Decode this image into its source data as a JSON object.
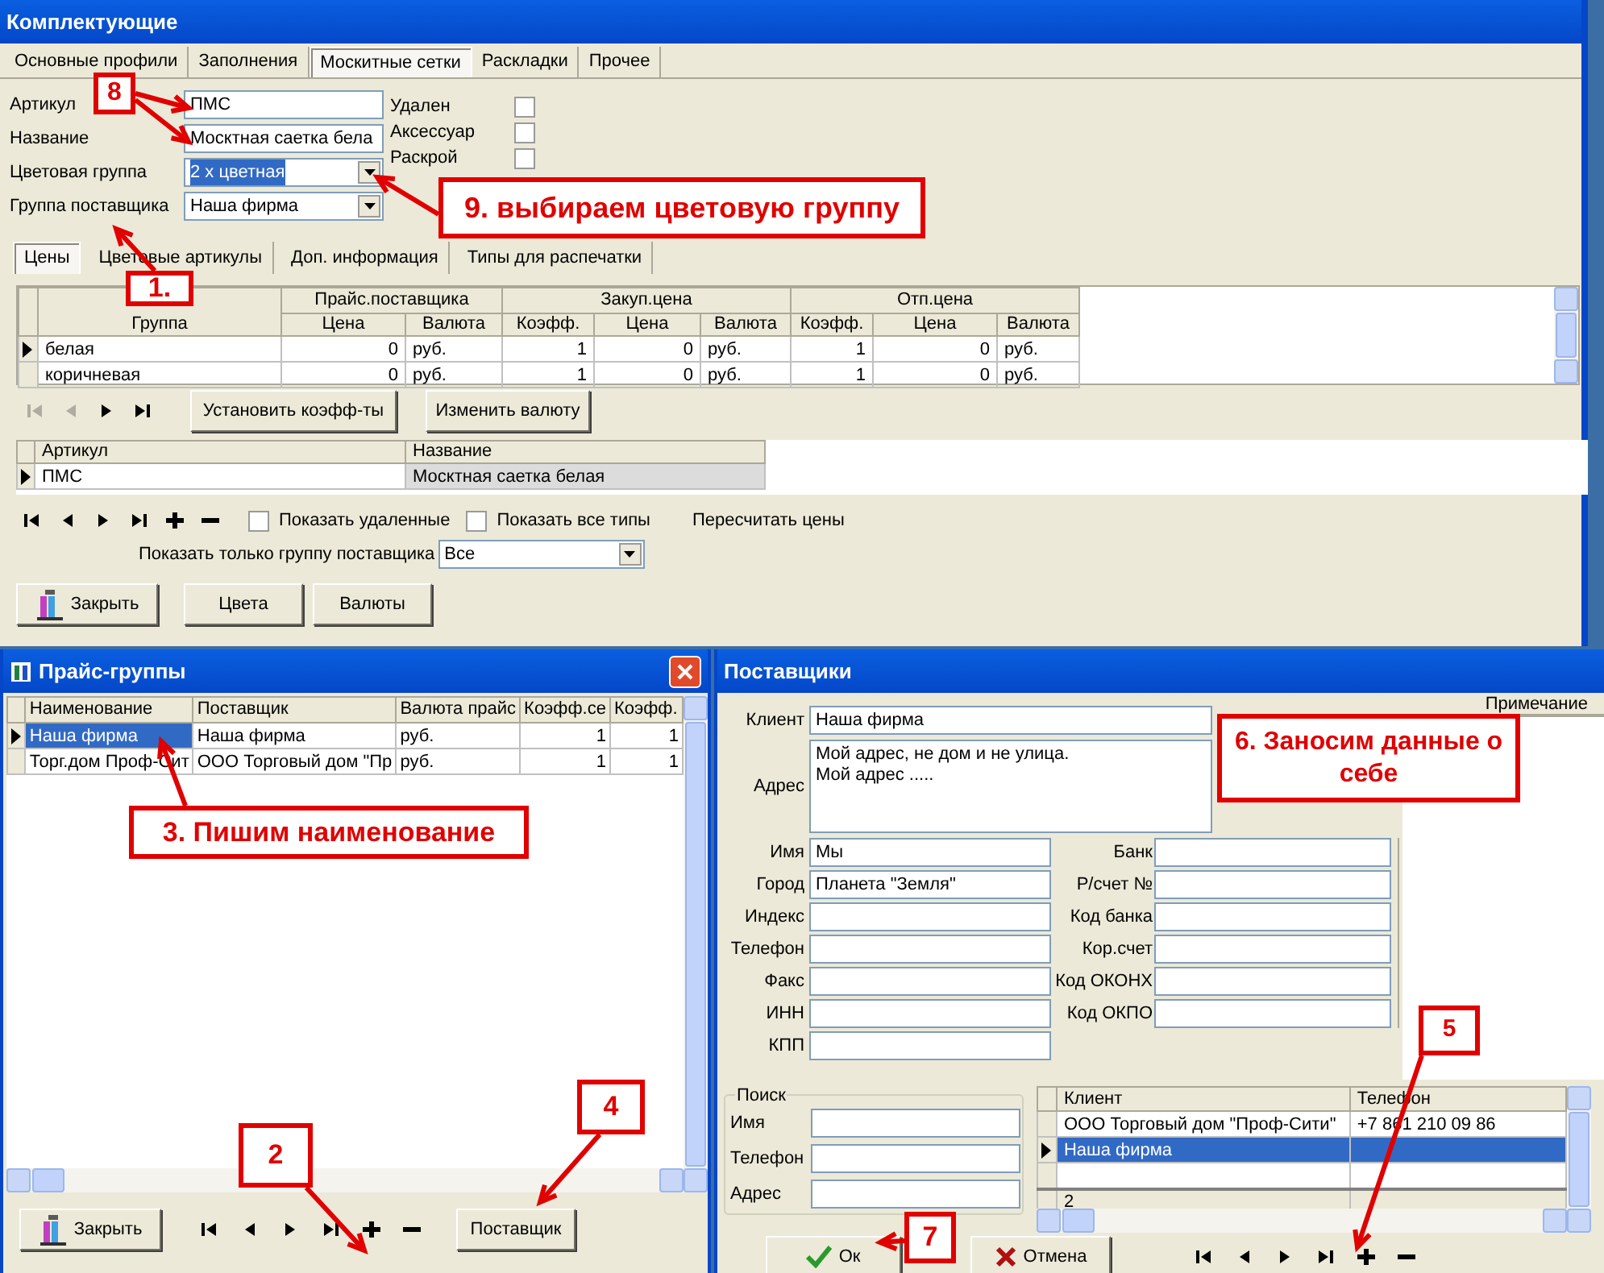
{
  "components_window": {
    "title": "Комплектующие",
    "tabs": [
      {
        "label": "Основные профили",
        "selected": false
      },
      {
        "label": "Заполнения",
        "selected": false
      },
      {
        "label": "Москитные сетки",
        "selected": true
      },
      {
        "label": "Раскладки",
        "selected": false
      },
      {
        "label": "Прочее",
        "selected": false
      }
    ],
    "fields": [
      {
        "label": "Артикул",
        "value": "ПМС",
        "kind": "text",
        "text_selected": false
      },
      {
        "label": "Название",
        "value": "Москтная саетка бела",
        "kind": "text",
        "text_selected": false
      },
      {
        "label": "Цветовая группа",
        "value": "2 х цветная",
        "kind": "combo",
        "text_selected": true
      },
      {
        "label": "Группа поставщика",
        "value": "Наша фирма",
        "kind": "combo",
        "text_selected": false
      }
    ],
    "flags": [
      {
        "label": "Удален",
        "checked": false
      },
      {
        "label": "Аксессуар",
        "checked": false
      },
      {
        "label": "Раскрой",
        "checked": false
      }
    ],
    "subtabs": [
      {
        "label": "Цены",
        "selected": true
      },
      {
        "label": "Цветовые артикулы",
        "selected": false
      },
      {
        "label": "Доп. информация",
        "selected": false
      },
      {
        "label": "Типы для распечатки",
        "selected": false
      }
    ],
    "prices_grid": {
      "first_column": "Группа",
      "header_groups": [
        {
          "label": "Прайс.поставщика",
          "columns": [
            "Цена",
            "Валюта"
          ]
        },
        {
          "label": "Закуп.цена",
          "columns": [
            "Коэфф.",
            "Цена",
            "Валюта"
          ]
        },
        {
          "label": "Отп.цена",
          "columns": [
            "Коэфф.",
            "Цена",
            "Валюта"
          ]
        }
      ],
      "rows": [
        {
          "cells": [
            "белая",
            "0",
            "руб.",
            "1",
            "0",
            "руб.",
            "1",
            "0",
            "руб."
          ],
          "current": true
        },
        {
          "cells": [
            "коричневая",
            "0",
            "руб.",
            "1",
            "0",
            "руб.",
            "1",
            "0",
            "руб."
          ],
          "current": false
        }
      ]
    },
    "prices_navigator": [
      {
        "kind": "first",
        "disabled": true
      },
      {
        "kind": "prev",
        "disabled": true
      },
      {
        "kind": "next",
        "disabled": false
      },
      {
        "kind": "last",
        "disabled": false
      }
    ],
    "prices_buttons": [
      "Установить коэфф-ты",
      "Изменить валюту"
    ],
    "items_grid": {
      "columns": [
        "Артикул",
        "Название"
      ],
      "rows": [
        {
          "cells": [
            "ПМС",
            "Москтная саетка белая"
          ],
          "current": true
        }
      ]
    },
    "items_navigator": [
      {
        "kind": "first",
        "disabled": false
      },
      {
        "kind": "prev",
        "disabled": false
      },
      {
        "kind": "next",
        "disabled": false
      },
      {
        "kind": "last",
        "disabled": false
      },
      {
        "kind": "add",
        "disabled": false
      },
      {
        "kind": "remove",
        "disabled": false
      }
    ],
    "filters": [
      {
        "label": "Показать удаленные",
        "checked": false
      },
      {
        "label": "Показать все типы",
        "checked": false
      }
    ],
    "recalc_label": "Пересчитать цены",
    "supplier_filter": {
      "label": "Показать только группу поставщика",
      "value": "Все"
    },
    "buttons": [
      {
        "label": "Закрыть",
        "kind": "close"
      },
      {
        "label": "Цвета",
        "kind": "plain"
      },
      {
        "label": "Валюты",
        "kind": "plain"
      }
    ]
  },
  "price_groups_window": {
    "title": "Прайс-группы",
    "columns": [
      "Наименование",
      "Поставщик",
      "Валюта прайс",
      "Коэфф.се",
      "Коэфф."
    ],
    "rows": [
      {
        "cells": [
          "Наша фирма",
          "Наша фирма",
          "руб.",
          "1",
          "1"
        ],
        "current": true,
        "selected": true
      },
      {
        "cells": [
          "Торг.дом Проф-Сит",
          "ООО Торговый дом \"Пр",
          "руб.",
          "1",
          "1"
        ],
        "current": false,
        "selected": false
      }
    ],
    "close_button": {
      "label": "Закрыть"
    },
    "navigator": [
      {
        "kind": "first",
        "disabled": false
      },
      {
        "kind": "prev",
        "disabled": false
      },
      {
        "kind": "next",
        "disabled": false
      },
      {
        "kind": "last",
        "disabled": false
      },
      {
        "kind": "add",
        "disabled": false
      },
      {
        "kind": "remove",
        "disabled": false
      }
    ],
    "supplier_button": "Поставщик"
  },
  "suppliers_window": {
    "title": "Поставщики",
    "client": {
      "label": "Клиент",
      "value": "Наша фирма"
    },
    "address": {
      "label": "Адрес",
      "lines": [
        "Мой адрес, не дом и не улица.",
        "Мой адрес ....."
      ]
    },
    "notes_header": "Примечание",
    "left_fields": [
      {
        "label": "Имя",
        "value": "Мы"
      },
      {
        "label": "Город",
        "value": "Планета \"Земля\""
      },
      {
        "label": "Индекс"
      },
      {
        "label": "Телефон"
      },
      {
        "label": "Факс"
      },
      {
        "label": "ИНН"
      },
      {
        "label": "КПП"
      }
    ],
    "right_fields": [
      {
        "label": "Банк"
      },
      {
        "label": "Р/счет №"
      },
      {
        "label": "Код банка"
      },
      {
        "label": "Кор.счет"
      },
      {
        "label": "Код ОКОНХ"
      },
      {
        "label": "Код ОКПО"
      }
    ],
    "search": {
      "title": "Поиск",
      "fields": [
        {
          "label": "Имя"
        },
        {
          "label": "Телефон"
        },
        {
          "label": "Адрес"
        }
      ]
    },
    "grid": {
      "columns": [
        "Клиент",
        "Телефон"
      ],
      "rows": [
        {
          "cells": [
            "ООО Торговый дом \"Проф-Сити\"",
            "+7 861 210 09 86"
          ],
          "current": false,
          "selected": false,
          "kind": "data"
        },
        {
          "cells": [
            "Наша фирма",
            ""
          ],
          "current": true,
          "selected": true,
          "kind": "data"
        },
        {
          "cells": [
            "",
            ""
          ],
          "current": false,
          "selected": false,
          "kind": "data"
        },
        {
          "cells": [
            "2",
            ""
          ],
          "current": false,
          "selected": false,
          "kind": "total"
        }
      ]
    },
    "buttons": [
      {
        "label": "Ок",
        "kind": "ok"
      },
      {
        "label": "Отмена",
        "kind": "cancel"
      }
    ],
    "navigator": [
      {
        "kind": "first",
        "disabled": false
      },
      {
        "kind": "prev",
        "disabled": false
      },
      {
        "kind": "next",
        "disabled": false
      },
      {
        "kind": "last",
        "disabled": false
      },
      {
        "kind": "add",
        "disabled": false
      },
      {
        "kind": "remove",
        "disabled": false
      }
    ]
  },
  "annotations": [
    {
      "text": "8"
    },
    {
      "text": "9. выбираем цветовую группу"
    },
    {
      "text": "1."
    },
    {
      "text": "3. Пишим наименование"
    },
    {
      "text": "2"
    },
    {
      "text": "4"
    },
    {
      "text": "6. Заносим данные о себе"
    },
    {
      "text": "5"
    },
    {
      "text": "7"
    }
  ]
}
